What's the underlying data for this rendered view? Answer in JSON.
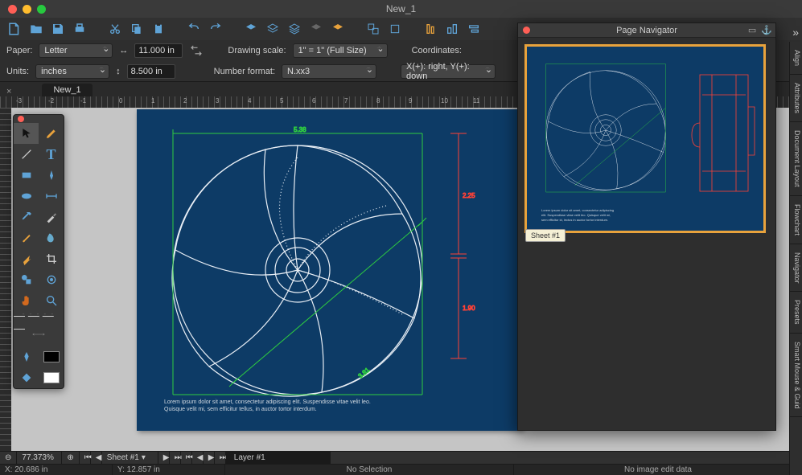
{
  "window": {
    "title": "New_1"
  },
  "props": {
    "paper_label": "Paper:",
    "paper": "Letter",
    "width_label": "↔",
    "width": "11.000 in",
    "units_label": "Units:",
    "units": "inches",
    "height_label": "↕",
    "height": "8.500 in",
    "scale_label": "Drawing scale:",
    "scale": "1\" = 1\"  (Full Size)",
    "numfmt_label": "Number format:",
    "numfmt": "N.xx3",
    "coords_label": "Coordinates:",
    "coords": "X(+): right, Y(+): down"
  },
  "tab": {
    "close": "×",
    "name": "New_1"
  },
  "dims": {
    "w": "5.38",
    "h1": "2.25",
    "h2": "1.90",
    "diag": "3.81"
  },
  "lorem": "Lorem ipsum dolor sit amet, consectetur adipiscing elit. Suspendisse vitae velit leo. Quisque velit mi, sem efficitur tellus, in auctor tortor interdum.",
  "navigator": {
    "title": "Page Navigator",
    "thumb": "Sheet #1"
  },
  "rtabs": [
    "Align",
    "Attributes",
    "Document Layout",
    "Flowchart",
    "Navigator",
    "Presets",
    "Smart Mouse & Guid"
  ],
  "status": {
    "zoom": "77.373%",
    "sheet": "Sheet #1",
    "layer": "Layer #1",
    "x": "X: 20.686 in",
    "y": "Y: 12.857 in",
    "sel": "No Selection",
    "img": "No image edit data"
  },
  "tools": {
    "select": "select",
    "pen": "pen",
    "line": "line",
    "text": "text",
    "rect": "rect",
    "bezier": "bezier",
    "ellipse": "ellipse",
    "dim": "dim",
    "eyedrop": "eyedrop",
    "knife": "knife",
    "brush": "brush",
    "smudge": "smudge",
    "goo": "goo",
    "crop": "crop",
    "shape": "shape",
    "zoom2": "zoom2",
    "hand": "hand",
    "magnify": "magnify",
    "dash": "dash",
    "arrows": "arrows",
    "nib": "nib",
    "blackswatch": "black",
    "whiteswatch": "white"
  }
}
